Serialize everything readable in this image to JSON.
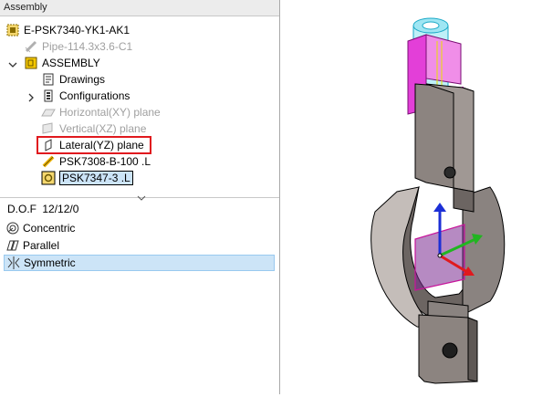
{
  "panel": {
    "title": "Assembly"
  },
  "tree": {
    "root": "E-PSK7340-YK1-AK1",
    "pipe": "Pipe-114.3x3.6-C1",
    "assembly": "ASSEMBLY",
    "drawings": "Drawings",
    "configurations": "Configurations",
    "horizontal_plane": "Horizontal(XY) plane",
    "vertical_plane": "Vertical(XZ) plane",
    "lateral_plane": "Lateral(YZ) plane",
    "part1": "PSK7308-B-100 .L",
    "part2": "PSK7347-3 .L"
  },
  "constraints": {
    "dof_label": "D.O.F",
    "dof_value": "12/12/0",
    "items": [
      "Concentric",
      "Parallel",
      "Symmetric"
    ],
    "selected": "Symmetric"
  },
  "colors": {
    "highlight_border": "#e0191e",
    "selection": "#cce4f7",
    "axis_x": "#e0191e",
    "axis_y": "#21b521",
    "axis_z": "#1c2fd6",
    "plane": "#c8149b",
    "pipe": "#7fdcef"
  }
}
